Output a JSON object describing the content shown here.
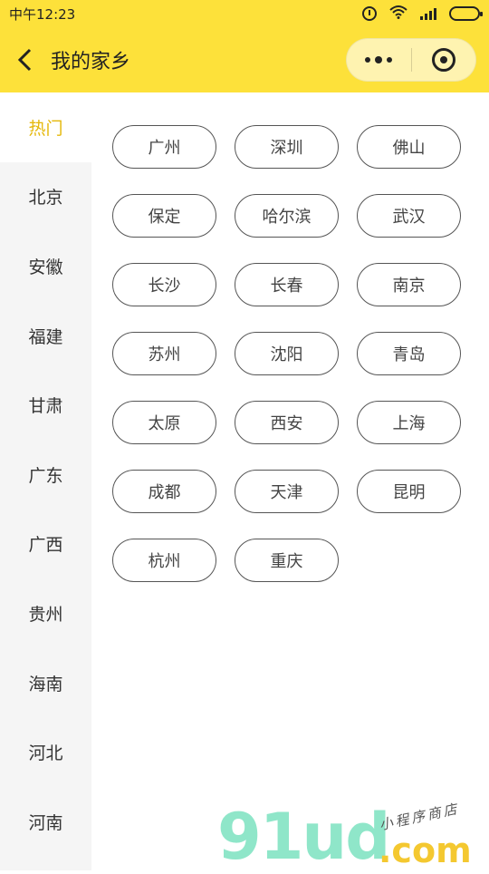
{
  "status_bar": {
    "time": "中午12:23"
  },
  "nav": {
    "title": "我的家乡"
  },
  "sidebar": {
    "items": [
      {
        "label": "热门",
        "active": true
      },
      {
        "label": "北京"
      },
      {
        "label": "安徽"
      },
      {
        "label": "福建"
      },
      {
        "label": "甘肃"
      },
      {
        "label": "广东"
      },
      {
        "label": "广西"
      },
      {
        "label": "贵州"
      },
      {
        "label": "海南"
      },
      {
        "label": "河北"
      },
      {
        "label": "河南"
      }
    ]
  },
  "cities": [
    "广州",
    "深圳",
    "佛山",
    "保定",
    "哈尔滨",
    "武汉",
    "长沙",
    "长春",
    "南京",
    "苏州",
    "沈阳",
    "青岛",
    "太原",
    "西安",
    "上海",
    "成都",
    "天津",
    "昆明",
    "杭州",
    "重庆"
  ],
  "watermark": {
    "logo": "91ud",
    "domain": ".com",
    "subtitle": "小程序商店"
  },
  "colors": {
    "brand_yellow": "#fde13a",
    "active_text": "#e5b80b",
    "sidebar_bg": "#f5f5f5"
  }
}
